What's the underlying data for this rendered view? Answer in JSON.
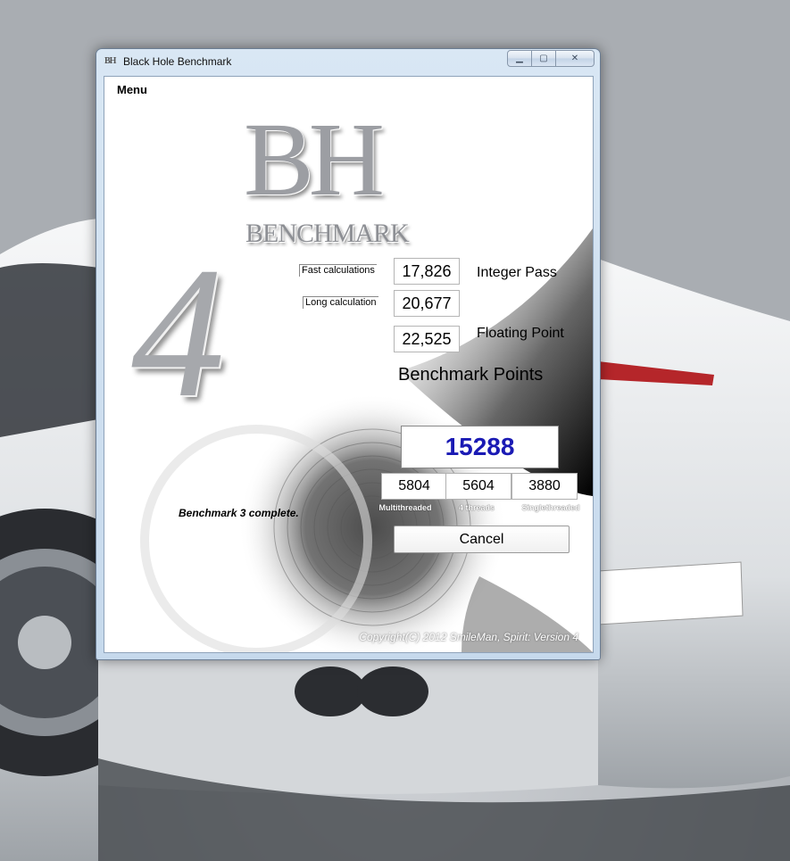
{
  "window": {
    "title": "Black Hole Benchmark",
    "icon_text": "BH"
  },
  "menu": {
    "label": "Menu"
  },
  "logo": {
    "letters": "BH",
    "word": "BENCHMARK",
    "version_digit": "4"
  },
  "results": {
    "fast_label": "Fast calculations",
    "fast_value": "17,826",
    "long_label": "Long calculation",
    "long_value": "20,677",
    "fp_value": "22,525",
    "integer_pass_label": "Integer Pass",
    "floating_point_label": "Floating Point",
    "benchmark_points_label": "Benchmark Points",
    "score": "15288",
    "multithreaded_value": "5804",
    "four_threads_value": "5604",
    "singlethreaded_value": "3880",
    "multithreaded_label": "Multithreaded",
    "four_threads_label": "4 threads",
    "singlethreaded_label": "Singlethreaded"
  },
  "status": "Benchmark 3 complete.",
  "cancel_label": "Cancel",
  "copyright": "Copyright(C) 2012 SmileMan, Spirit: Version 4",
  "colors": {
    "score": "#1a1ab4",
    "window_frame": "#c6d9ec"
  }
}
